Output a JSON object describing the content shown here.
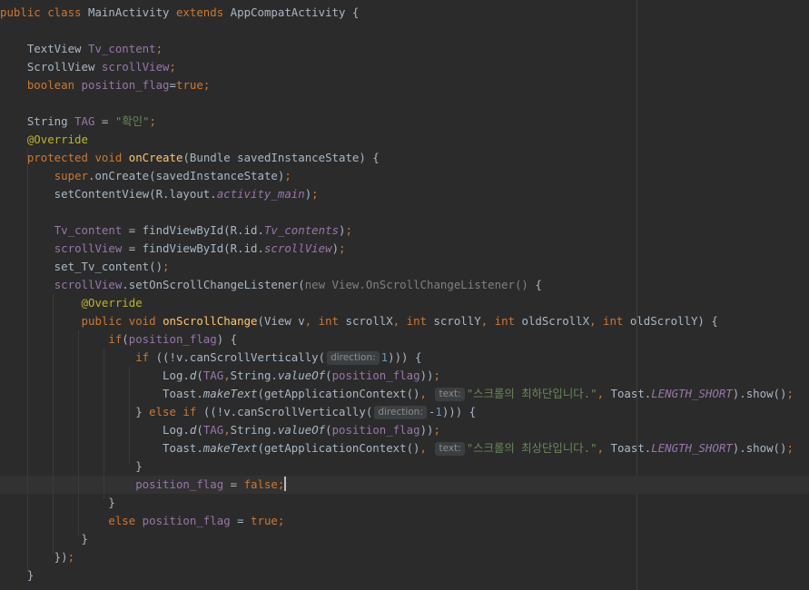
{
  "editor": {
    "hint_direction": "direction:",
    "hint_text": "text:",
    "toast_bottom": "\"스크롤의 최하단입니다.\"",
    "toast_top": "\"스크롤의 최상단입니다.\"",
    "tag_value": "\"확인\""
  },
  "colors": {
    "background": "#2b2b2b",
    "keyword": "#cc7832",
    "string": "#6a8759",
    "field": "#9876aa",
    "annotation": "#bbb529",
    "method_decl": "#ffc66d",
    "number": "#6897bb"
  }
}
